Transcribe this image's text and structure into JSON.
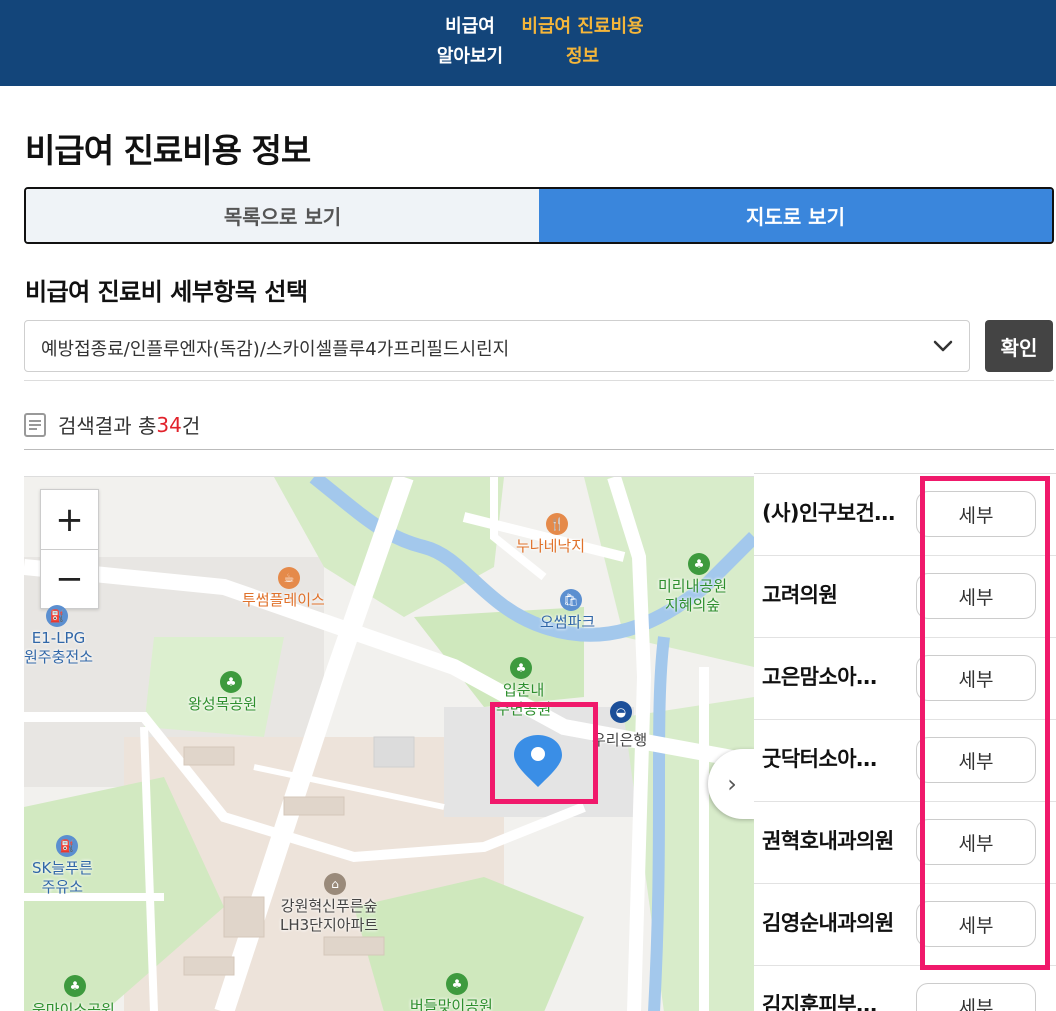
{
  "header": {
    "nav_1": [
      "비급여",
      "알아보기"
    ],
    "nav_2": [
      "비급여 진료비용",
      "정보"
    ]
  },
  "page_title": "비급여 진료비용 정보",
  "view_toggle": {
    "list_label": "목록으로 보기",
    "map_label": "지도로 보기",
    "active": "map"
  },
  "section_label": "비급여 진료비 세부항목 선택",
  "select": {
    "value": "예방접종료/인플루엔자(독감)/스카이셀플루4가프리필드시린지"
  },
  "confirm_label": "확인",
  "result": {
    "prefix": "검색결과 총",
    "count": "34",
    "suffix": "건"
  },
  "map": {
    "zoom_in": "+",
    "zoom_out": "−",
    "labels": {
      "nunanaenakji": "누나네낙지",
      "twosome": "투썸플레이스",
      "e1_lpg": [
        "E1-LPG",
        "원주충전소"
      ],
      "osseom_park": "오썸파크",
      "mirinae": [
        "미리내공원",
        "지혜의숲"
      ],
      "wangseongmok": "왕성목공원",
      "ipchunnae": [
        "입춘내",
        "수변공원"
      ],
      "woori_bank": "우리은행",
      "sk": [
        "SK늘푸른",
        "주유소"
      ],
      "gangwon_apt": [
        "강원혁신푸른숲",
        "LH3단지아파트"
      ],
      "beodeulmaei": "버들맞이공원",
      "umaisu": "움마이소공원"
    },
    "colors": {
      "water": "#a3c8ec",
      "park": "#cfe8bd",
      "road": "#ffffff",
      "pin": "#3a8ee6",
      "highlight": "#f0196b"
    }
  },
  "hospitals": [
    {
      "name": "(사)인구보건…",
      "detail": "세부"
    },
    {
      "name": "고려의원",
      "detail": "세부"
    },
    {
      "name": "고은맘소아…",
      "detail": "세부"
    },
    {
      "name": "굿닥터소아…",
      "detail": "세부"
    },
    {
      "name": "권혁호내과의원",
      "detail": "세부"
    },
    {
      "name": "김영순내과의원",
      "detail": "세부"
    },
    {
      "name": "김지훈피부…",
      "detail": "세부"
    }
  ]
}
